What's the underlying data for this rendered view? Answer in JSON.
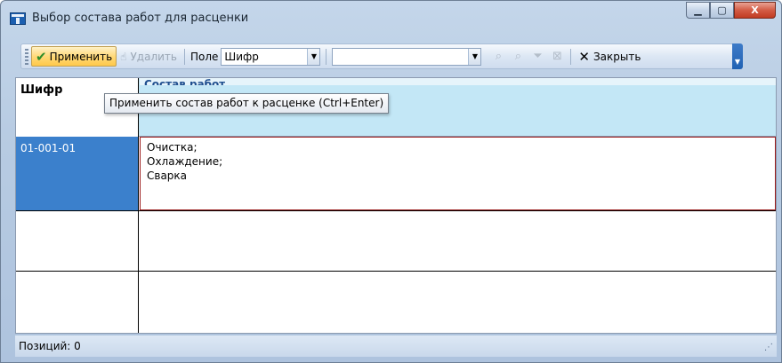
{
  "window": {
    "title": "Выбор состава работ для расценки",
    "minimize_glyph": "▁",
    "maximize_glyph": "▢",
    "close_glyph": "X"
  },
  "toolbar": {
    "apply_label": "Применить",
    "delete_label": "Удалить",
    "field_label": "Поле",
    "field_value": "Шифр",
    "search_value": "",
    "close_label": "Закрыть"
  },
  "tooltip": {
    "text": "Применить состав работ к расценке (Ctrl+Enter)"
  },
  "grid": {
    "headers": {
      "code": "Шифр",
      "composition": "Состав работ"
    },
    "rows": [
      {
        "code": "01-001-01",
        "composition": "Очистка;\nОхлаждение;\nСварка"
      },
      {
        "code": "",
        "composition": ""
      },
      {
        "code": "",
        "composition": ""
      }
    ]
  },
  "status": {
    "positions_text": "Позиций: 0"
  },
  "colors": {
    "selected_cell": "#3b80cc",
    "header_band": "#c3e7f6",
    "selected_row_border": "#9b1b1b"
  }
}
